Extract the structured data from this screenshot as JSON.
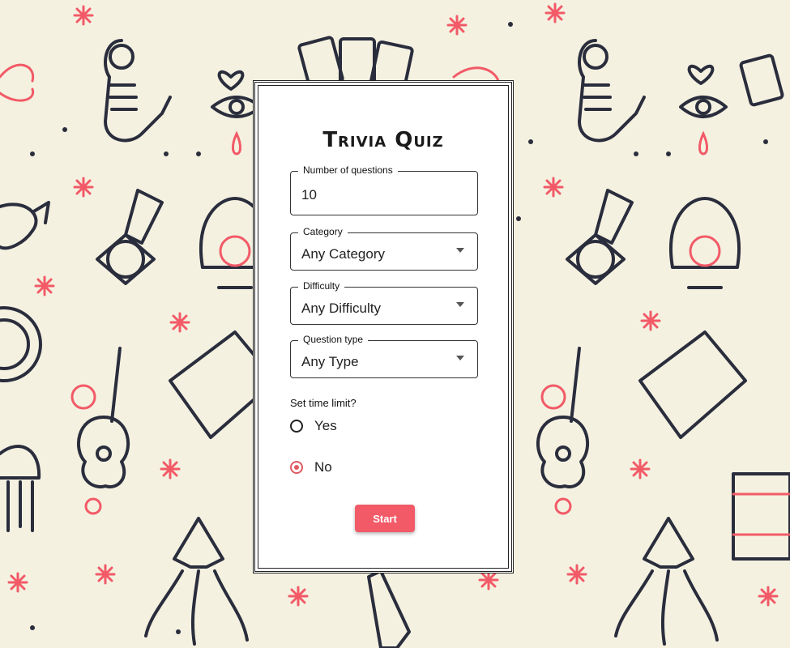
{
  "colors": {
    "background": "#f4f1e1",
    "accent": "#f25a67",
    "ink": "#2a2d3c"
  },
  "title": "Trivia Quiz",
  "fields": {
    "questions": {
      "label": "Number of questions",
      "value": "10"
    },
    "category": {
      "label": "Category",
      "value": "Any Category"
    },
    "difficulty": {
      "label": "Difficulty",
      "value": "Any Difficulty"
    },
    "type": {
      "label": "Question type",
      "value": "Any Type"
    }
  },
  "time_limit": {
    "label": "Set time limit?",
    "options": [
      {
        "label": "Yes",
        "checked": false
      },
      {
        "label": "No",
        "checked": true
      }
    ]
  },
  "start_label": "Start",
  "background_icons": [
    "mermaid-icon",
    "playing-cards-icon",
    "eye-icon",
    "broken-heart-icon",
    "medal-icon",
    "oyster-pearl-icon",
    "whale-icon",
    "porthole-icon",
    "ukulele-icon",
    "treasure-map-icon",
    "jellyfish-icon",
    "squid-icon",
    "bottle-icon",
    "life-vest-icon",
    "hibiscus-icon",
    "star-icon"
  ]
}
